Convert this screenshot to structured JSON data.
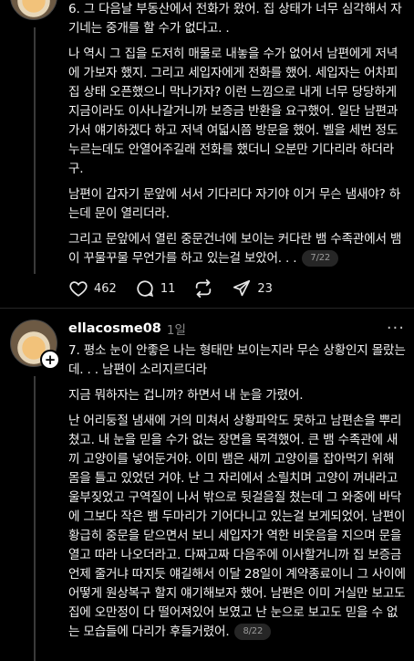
{
  "post1": {
    "paragraphs": [
      "6. 그 다음날 부동산에서 전화가 왔어. 집 상태가 너무 심각해서 자기네는 중개를 할 수가 없다고. .",
      "나 역시 그 집을 도저히 매물로 내놓을 수가 없어서 남편에게 저녁에 가보자 했지. 그리고 세입자에게 전화를 했어. 세입자는 어차피 집 상태 오픈했으니 막나가자? 이런 느낌으로 내게 너무 당당하게 지금이라도 이사나갈거니까 보증금 반환을 요구했어. 일단 남편과 가서 얘기하겠다 하고 저녁 여덟시쯤 방문을 했어. 벨을 세번 정도 누르는데도 안열어주길래 전화를 했더니 오분만 기다리라 하더라구.",
      "남편이 갑자기 문앞에 서서 기다리다 자기야 이거 무슨 냄새야? 하는데 문이 열리더라.",
      "그리고 문앞에서 열린 중문건너에 보이는 커다란 뱀 수족관에서 뱀이 꾸물꾸물 무언가를 하고 있는걸 보았어. . ."
    ],
    "page_badge": "7/22",
    "likes": "462",
    "comments": "11",
    "reposts": "",
    "shares": "23"
  },
  "post2": {
    "username": "ellacosme08",
    "time": "1일",
    "more": "···",
    "paragraphs": [
      "7. 평소 눈이 안좋은 나는 형태만 보이는지라 무슨 상황인지 몰랐는데. . . 남편이 소리지르더라",
      "지금 뭐하자는 겁니까? 하면서 내 눈을 가렸어.",
      "난 어리둥절 냄새에 거의 미쳐서 상황파악도 못하고 남편손을 뿌리쳤고. 내 눈을 믿을 수가 없는 장면을 목격했어. 큰 뱀 수족관에 새끼 고양이를 넣어둔거야. 이미 뱀은 새끼 고양이를 잡아먹기 위해 몸을 틀고 있었던 거야. 난 그 자리에서 소릴치며 고양이 꺼내라고 울부짖었고 구역질이 나서 밖으로 뒷걸음질 쳤는데 그 와중에 바닥에 그보다 작은 뱀 두마리가 기어다니고 있는걸 보게되었어. 남편이 황급히 중문을 닫으면서 보니 세입자가 역한 비웃음을 지으며 문을 열고 따라 나오더라고. 다짜고짜 다음주에 이사할거니까 집 보증금 언제 줄거냐 따지듯 얘길해서 이달 28일이 계약종료이니 그 사이에 어떻게 원상복구 할지 얘기해보자 했어. 남편은 이미 거실만 보고도 집에 오만정이 다 떨어져있어 보였고 난 눈으로 보고도 믿을 수 없는 모습들에 다리가 후들거렸어."
    ],
    "page_badge": "8/22"
  }
}
